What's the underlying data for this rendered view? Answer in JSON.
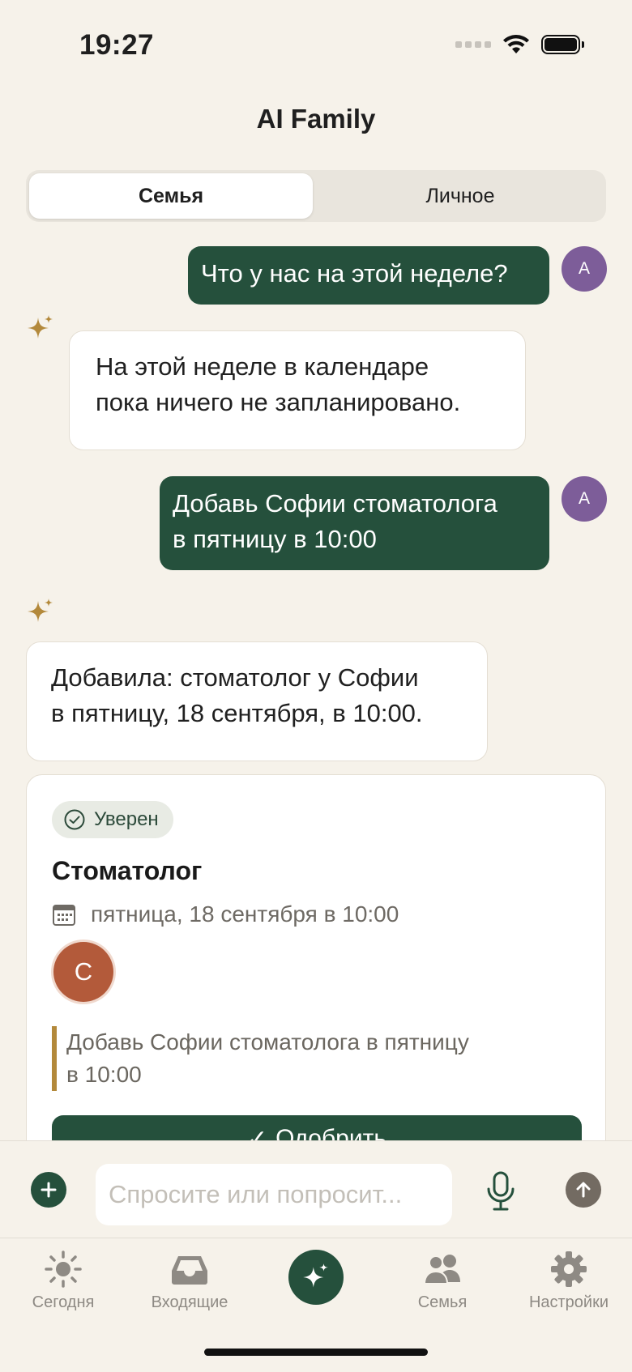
{
  "status_bar": {
    "time": "19:27"
  },
  "header": {
    "title": "AI Family"
  },
  "segmented": {
    "active": "Семья",
    "inactive": "Личное"
  },
  "messages": {
    "user_1": {
      "text": "Что у нас на этой неделе?",
      "avatar": "A"
    },
    "ai_1": {
      "line1": "На этой неделе в календаре",
      "line2": "пока ничего не запланировано."
    },
    "user_2": {
      "line1": "Добавь Софии стоматолога",
      "line2": "в пятницу в 10:00",
      "avatar": "A"
    },
    "ai_2": {
      "line1": "Добавила: стоматолог у Софии",
      "line2": "в пятницу, 18 сентября, в 10:00."
    }
  },
  "event_card": {
    "badge": "Уверен",
    "title": "Стоматолог",
    "date": "пятница, 18 сентября в 10:00",
    "avatar": "С",
    "quote_line1": "Добавь Софии стоматолога в пятницу",
    "quote_line2": "в 10:00",
    "approve_label": "Одобрить"
  },
  "composer": {
    "placeholder": "Спросите или попросит..."
  },
  "tabs": {
    "today": "Сегодня",
    "inbox": "Входящие",
    "family": "Семья",
    "settings": "Настройки"
  },
  "colors": {
    "background": "#f6f2ea",
    "primary_green": "#25503c",
    "user_avatar": "#7d5d99",
    "card_avatar": "#b35a3a",
    "sparkle": "#b3893b"
  }
}
